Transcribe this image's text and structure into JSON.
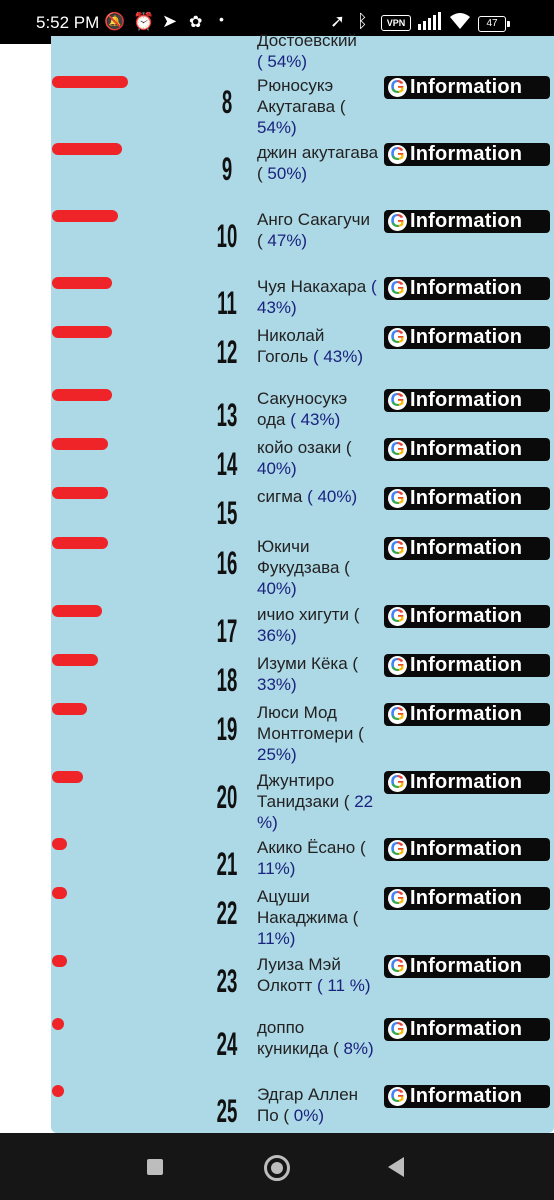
{
  "status_bar": {
    "time": "5:52 PM",
    "vpn": "VPN",
    "battery": "47",
    "icons": [
      "muted-notification-icon",
      "alarm-icon",
      "telegram-icon",
      "app-icon",
      "dot-icon",
      "location-icon",
      "bluetooth-icon",
      "vpn-icon",
      "signal-icon",
      "wifi-icon",
      "battery-icon"
    ]
  },
  "top_partial": {
    "name": "Достоевский",
    "pct": "( 54%)"
  },
  "button_label": "Information",
  "google_letter": "G",
  "rows": [
    {
      "rank": "8",
      "name": "Рюносукэ Акутагава (",
      "pct": "54%)",
      "bar": 0.54
    },
    {
      "rank": "9",
      "name": "джин акутагава (",
      "pct": "50%)",
      "bar": 0.5
    },
    {
      "rank": "10",
      "name": "Анго Сакагучи (",
      "pct": "47%)",
      "bar": 0.47
    },
    {
      "rank": "11",
      "name": "Чуя Накахара",
      "pct": "( 43%)",
      "bar": 0.43
    },
    {
      "rank": "12",
      "name": "Николай Гоголь",
      "pct": "( 43%)",
      "bar": 0.43
    },
    {
      "rank": "13",
      "name": "Сакуносукэ ода",
      "pct": "( 43%)",
      "bar": 0.43
    },
    {
      "rank": "14",
      "name": "койо озаки (",
      "pct": "40%)",
      "bar": 0.4
    },
    {
      "rank": "15",
      "name": "сигма",
      "pct": "( 40%)",
      "bar": 0.4
    },
    {
      "rank": "16",
      "name": "Юкичи Фукудзава (",
      "pct": "40%)",
      "bar": 0.4
    },
    {
      "rank": "17",
      "name": "ичио хигути (",
      "pct": "36%)",
      "bar": 0.36
    },
    {
      "rank": "18",
      "name": "Изуми Кёка (",
      "pct": "33%)",
      "bar": 0.33
    },
    {
      "rank": "19",
      "name": "Люси Мод Монтгомери (",
      "pct": "25%)",
      "bar": 0.25
    },
    {
      "rank": "20",
      "name": "Джунтиро Танидзаки (",
      "pct": "22 %)",
      "bar": 0.22
    },
    {
      "rank": "21",
      "name": "Акико Ёсано (",
      "pct": "11%)",
      "bar": 0.11
    },
    {
      "rank": "22",
      "name": "Ацуши Накаджима (",
      "pct": "11%)",
      "bar": 0.11
    },
    {
      "rank": "23",
      "name": "Луиза Мэй Олкотт",
      "pct": "( 11 %)",
      "bar": 0.11
    },
    {
      "rank": "24",
      "name": "доппо куникида (",
      "pct": "8%)",
      "bar": 0.08
    },
    {
      "rank": "25",
      "name": "Эдгар Аллен По (",
      "pct": "0%)",
      "bar": 0.0
    }
  ],
  "colors": {
    "panel": "#add8e6",
    "bar": "#ee2428",
    "button": "#0a0a0a",
    "percent": "#1a237e"
  }
}
